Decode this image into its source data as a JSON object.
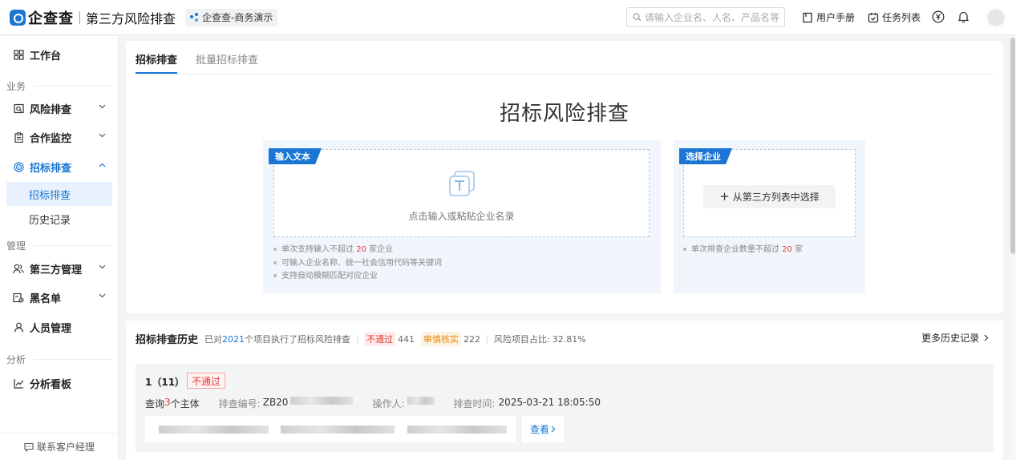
{
  "header": {
    "logo_text": "企查查",
    "product_name": "第三方风险排查",
    "org_name": "企查查-商务演示",
    "search_placeholder": "请输入企业名、人名、产品名等",
    "manual_label": "用户手册",
    "tasks_label": "任务列表",
    "brand_color": "#1a76d2"
  },
  "sidebar": {
    "workbench": "工作台",
    "group_business": "业务",
    "risk_check": "风险排查",
    "coop_monitor": "合作监控",
    "bid_check": "招标排查",
    "bid_check_sub": "招标排查",
    "history_sub": "历史记录",
    "group_manage": "管理",
    "third_party_manage": "第三方管理",
    "blacklist": "黑名单",
    "staff_manage": "人员管理",
    "group_analysis": "分析",
    "dashboard": "分析看板",
    "footer": "联系客户经理"
  },
  "tabs": {
    "active": "招标排查",
    "batch": "批量招标排查"
  },
  "hero_title": "招标风险排查",
  "input_panel": {
    "tag": "输入文本",
    "hint": "点击输入或粘贴企业名录",
    "tip1_pre": "单次支持输入不超过",
    "tip1_num": "20",
    "tip1_post": "家企业",
    "tip2": "可输入企业名称、统一社会信用代码等关键词",
    "tip3": "支持自动模糊匹配对应企业"
  },
  "select_panel": {
    "tag": "选择企业",
    "button": "从第三方列表中选择",
    "tip_pre": "单次排查企业数量不超过",
    "tip_num": "20",
    "tip_post": "家"
  },
  "history": {
    "title": "招标排查历史",
    "summary_pre": "已对",
    "summary_count": "2021",
    "summary_post": "个项目执行了招标风险排查",
    "fail_label": "不通过",
    "fail_count": "441",
    "review_label": "审慎核实",
    "review_count": "222",
    "risk_ratio_label": "风险项目占比:",
    "risk_ratio": "32.81%",
    "more_link": "更多历史记录",
    "item": {
      "title": "1（11）",
      "status": "不通过",
      "query_pre": "查询",
      "query_num": "3",
      "query_post": "个主体",
      "id_label": "排查编号:",
      "id_value": "ZB20",
      "operator_label": "操作人:",
      "time_label": "排查时间:",
      "time_value": "2025-03-21 18:05:50",
      "view_button": "查看"
    }
  }
}
